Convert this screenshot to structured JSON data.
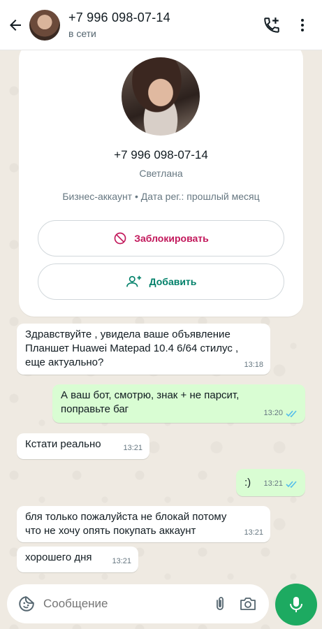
{
  "header": {
    "title": "+7 996 098-07-14",
    "status": "в сети",
    "icons": {
      "back": "arrow-left-icon",
      "call": "add-call-icon",
      "menu": "more-vert-icon"
    }
  },
  "profile": {
    "phone": "+7 996 098-07-14",
    "name": "Светлана",
    "meta": "Бизнес-аккаунт • Дата рег.: прошлый месяц",
    "block_label": "Заблокировать",
    "add_label": "Добавить",
    "colors": {
      "block": "#c2185b",
      "add": "#008069"
    }
  },
  "messages": [
    {
      "direction": "in",
      "text": "Здравствуйте , увидела ваше объявление\nПланшет Huawei Matepad 10.4 6/64   стилус ,\nеще актуально?",
      "time": "13:18"
    },
    {
      "direction": "out",
      "text": "А ваш бот, смотрю, знак + не парсит,\nпоправьте баг",
      "time": "13:20",
      "read": true
    },
    {
      "direction": "in",
      "text": "Кстати реально",
      "time": "13:21"
    },
    {
      "direction": "out",
      "text": ":)",
      "time": "13:21",
      "read": true
    },
    {
      "direction": "in",
      "text": "бля только пожалуйста не блокай потому\nчто не хочу опять покупать аккаунт",
      "time": "13:21"
    },
    {
      "direction": "in",
      "text": "хорошего дня",
      "time": "13:21"
    }
  ],
  "composer": {
    "placeholder": "Сообщение",
    "icons": {
      "emoji": "sticker-icon",
      "attach": "paperclip-icon",
      "camera": "camera-icon",
      "mic": "microphone-icon"
    }
  },
  "colors": {
    "accent": "#1daa61",
    "outgoing_bubble": "#d9fdd3",
    "read_ticks": "#53bdeb"
  }
}
